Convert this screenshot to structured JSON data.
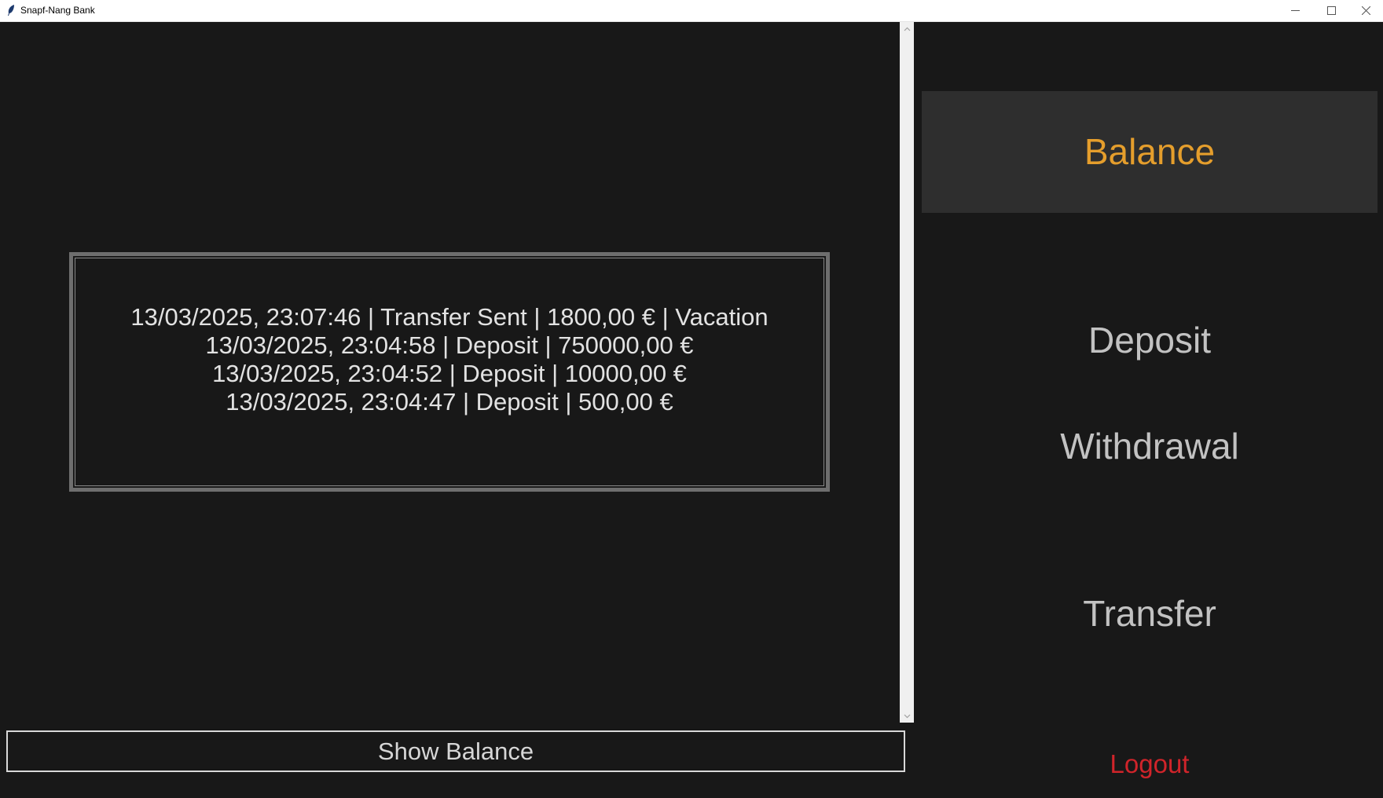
{
  "window": {
    "title": "Snapf-Nang Bank",
    "icons": {
      "app": "feather-icon",
      "minimize": "minimize-icon",
      "maximize": "maximize-icon",
      "close": "close-icon"
    }
  },
  "history": {
    "lines": [
      "13/03/2025, 23:07:46 | Transfer Sent | 1800,00 € | Vacation",
      "13/03/2025, 23:04:58 | Deposit | 750000,00 €",
      "13/03/2025, 23:04:52 | Deposit | 10000,00 €",
      "13/03/2025, 23:04:47 | Deposit | 500,00 €"
    ]
  },
  "main": {
    "show_balance_label": "Show Balance"
  },
  "sidebar": {
    "items": [
      {
        "label": "Balance",
        "active": true
      },
      {
        "label": "Deposit"
      },
      {
        "label": "Withdrawal"
      },
      {
        "label": "Transfer"
      }
    ],
    "logout_label": "Logout"
  },
  "colors": {
    "background": "#181818",
    "active_item_bg": "#2e2e2e",
    "active_item_text": "#e59e2c",
    "item_text": "#c2c2c2",
    "logout_text": "#d0242a"
  }
}
